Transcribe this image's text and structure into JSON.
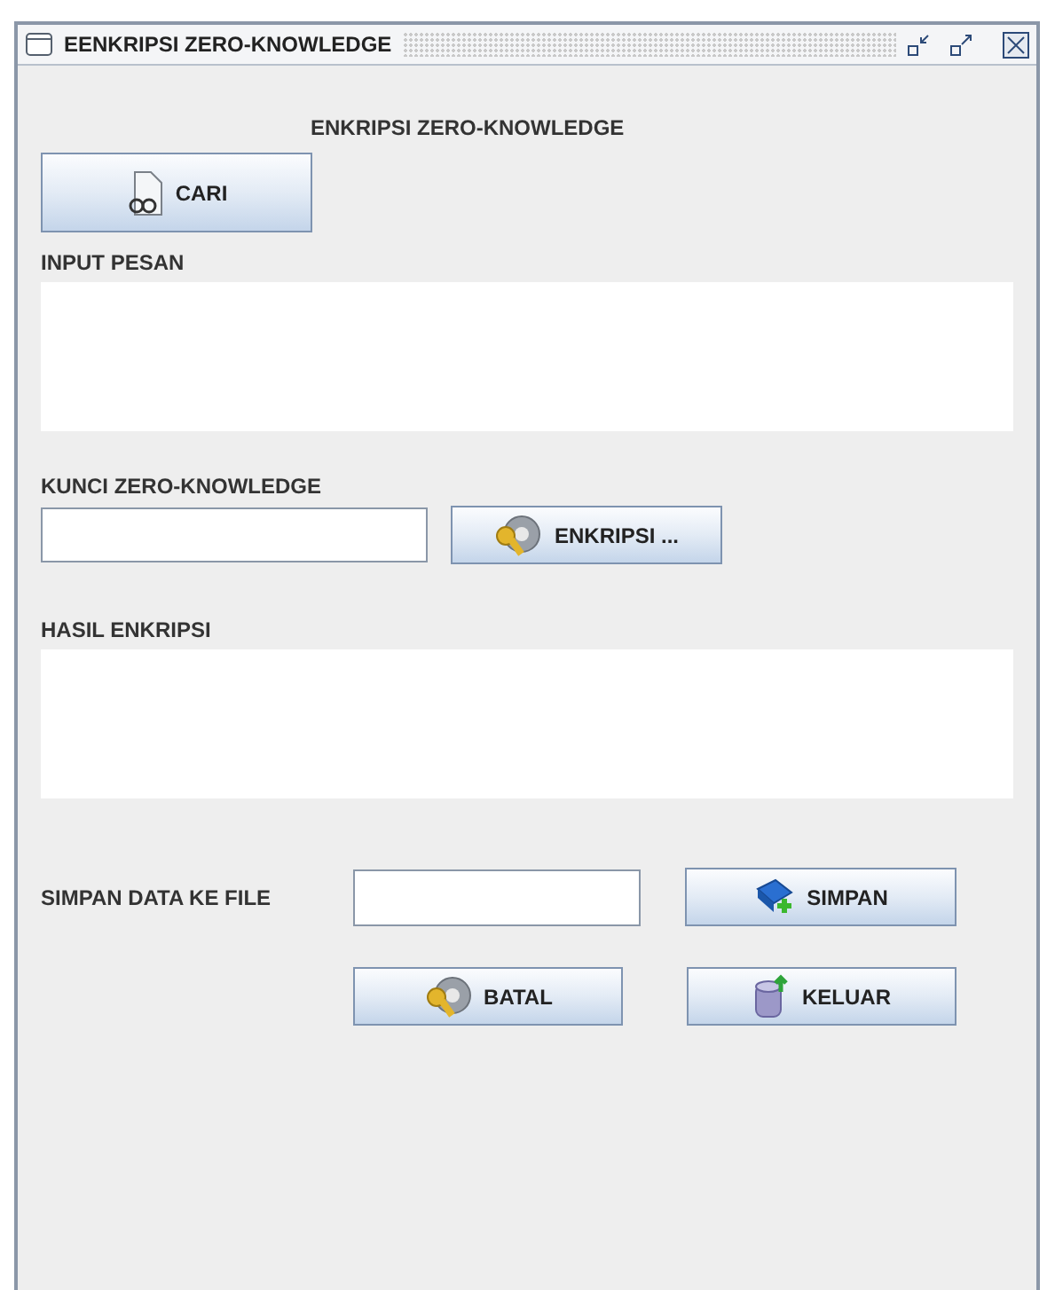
{
  "window": {
    "title": "EENKRIPSI ZERO-KNOWLEDGE"
  },
  "heading": "ENKRIPSI ZERO-KNOWLEDGE",
  "search_button": {
    "label": "CARI"
  },
  "input_message": {
    "label": "INPUT PESAN"
  },
  "key": {
    "label": "KUNCI ZERO-KNOWLEDGE",
    "button": "ENKRIPSI ..."
  },
  "result": {
    "label": "HASIL ENKRIPSI"
  },
  "save": {
    "label": "SIMPAN DATA KE FILE",
    "button": "SIMPAN"
  },
  "buttons": [
    {
      "label": "BATAL",
      "kind": "gear"
    },
    {
      "label": "KELUAR",
      "kind": "database"
    }
  ]
}
